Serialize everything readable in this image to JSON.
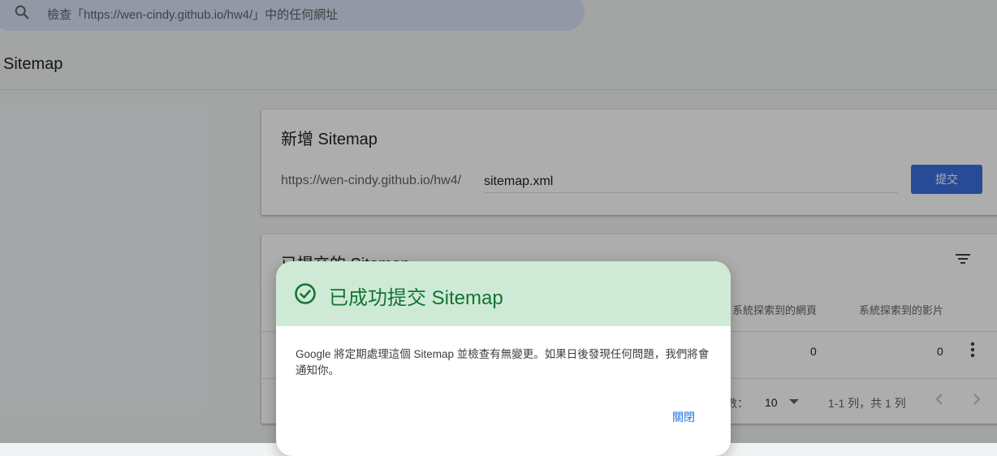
{
  "search": {
    "placeholder": "檢查「https://wen-cindy.github.io/hw4/」中的任何網址"
  },
  "page": {
    "title": "Sitemap"
  },
  "add_sitemap": {
    "title": "新增 Sitemap",
    "url_prefix": "https://wen-cindy.github.io/hw4/",
    "input_value": "sitemap.xml",
    "submit_label": "提交"
  },
  "submitted": {
    "title": "已提交的 Sitemap",
    "columns": [
      "系統探索到的網頁",
      "系統探索到的影片"
    ],
    "row": {
      "pages": "0",
      "videos": "0"
    },
    "footer": {
      "rows_label": "數：",
      "rows_value": "10",
      "range": "1-1 列，共 1 列"
    }
  },
  "dialog": {
    "title": "已成功提交 Sitemap",
    "body": "Google 將定期處理這個 Sitemap 並檢查有無變更。如果日後發現任何問題，我們將會通知你。",
    "close_label": "關閉"
  },
  "colors": {
    "accent": "#3c6fe0",
    "success_bg": "#ceead6",
    "success_text": "#137333",
    "link": "#1a73e8"
  },
  "icons": [
    "search-icon",
    "filter-icon",
    "more-vert-icon",
    "chevron-left-icon",
    "chevron-right-icon",
    "check-circle-icon",
    "dropdown-caret-icon"
  ]
}
